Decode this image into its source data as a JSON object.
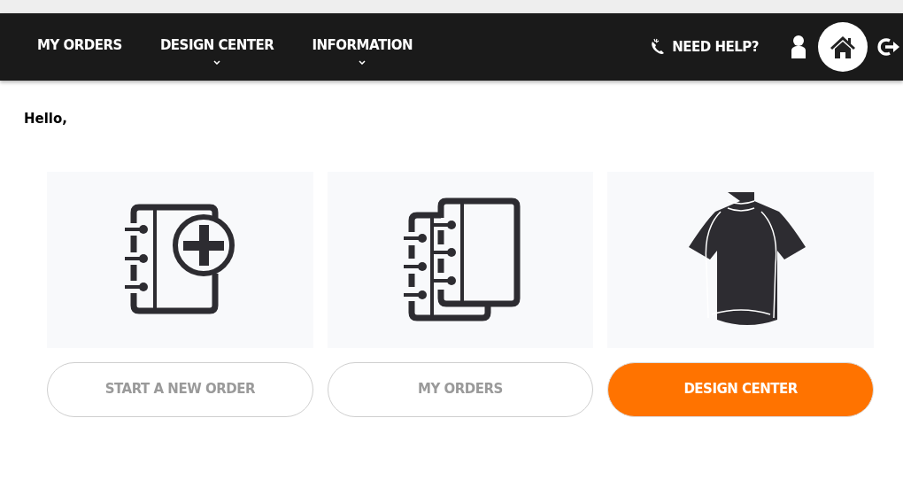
{
  "nav": {
    "items": [
      {
        "label": "MY ORDERS",
        "dropdown": false
      },
      {
        "label": "DESIGN CENTER",
        "dropdown": true
      },
      {
        "label": "INFORMATION",
        "dropdown": true
      }
    ],
    "help": "NEED HELP?"
  },
  "greeting": "Hello,",
  "cards": [
    {
      "kind": "new-order",
      "button": "START A NEW ORDER",
      "selected": false
    },
    {
      "kind": "orders",
      "button": "MY ORDERS",
      "selected": false
    },
    {
      "kind": "jersey",
      "button": "DESIGN CENTER",
      "selected": true
    }
  ]
}
